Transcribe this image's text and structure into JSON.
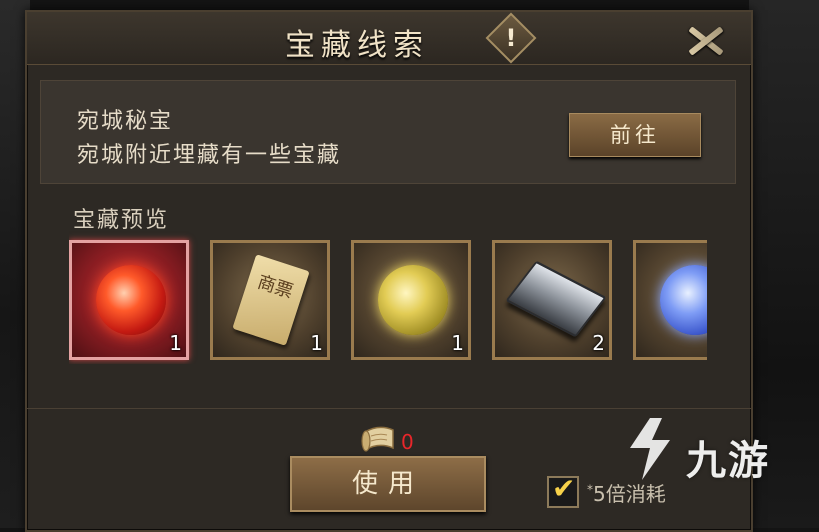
{
  "dialog": {
    "title": "宝藏线索",
    "info_icon": "exclamation-icon",
    "close_icon": "close-icon"
  },
  "quest": {
    "title": "宛城秘宝",
    "description": "宛城附近埋藏有一些宝藏",
    "goto_label": "前往"
  },
  "preview": {
    "label": "宝藏预览",
    "items": [
      {
        "icon": "red-orb-icon",
        "count": "1",
        "selected": true
      },
      {
        "icon": "merchant-ticket-icon",
        "ticket_text": "商票",
        "count": "1"
      },
      {
        "icon": "gold-orb-icon",
        "count": "1"
      },
      {
        "icon": "silver-ingot-icon",
        "count": "2"
      },
      {
        "icon": "blue-orb-icon",
        "count": ""
      }
    ]
  },
  "footer": {
    "scroll_icon": "treasure-map-scroll-icon",
    "scroll_count": "0",
    "scroll_count_color": "#e8262a",
    "use_label": "使用",
    "multiplier_checked": true,
    "multiplier_asterisk": "*",
    "multiplier_label": "5倍消耗"
  },
  "watermark": {
    "logo_text": "九游"
  },
  "colors": {
    "panel_bg": "#2d2924",
    "title_text": "#f0e2c6",
    "button_brown": "#8a6b45",
    "selected_slot": "#c63a3a",
    "check_yellow": "#f7d24a"
  }
}
